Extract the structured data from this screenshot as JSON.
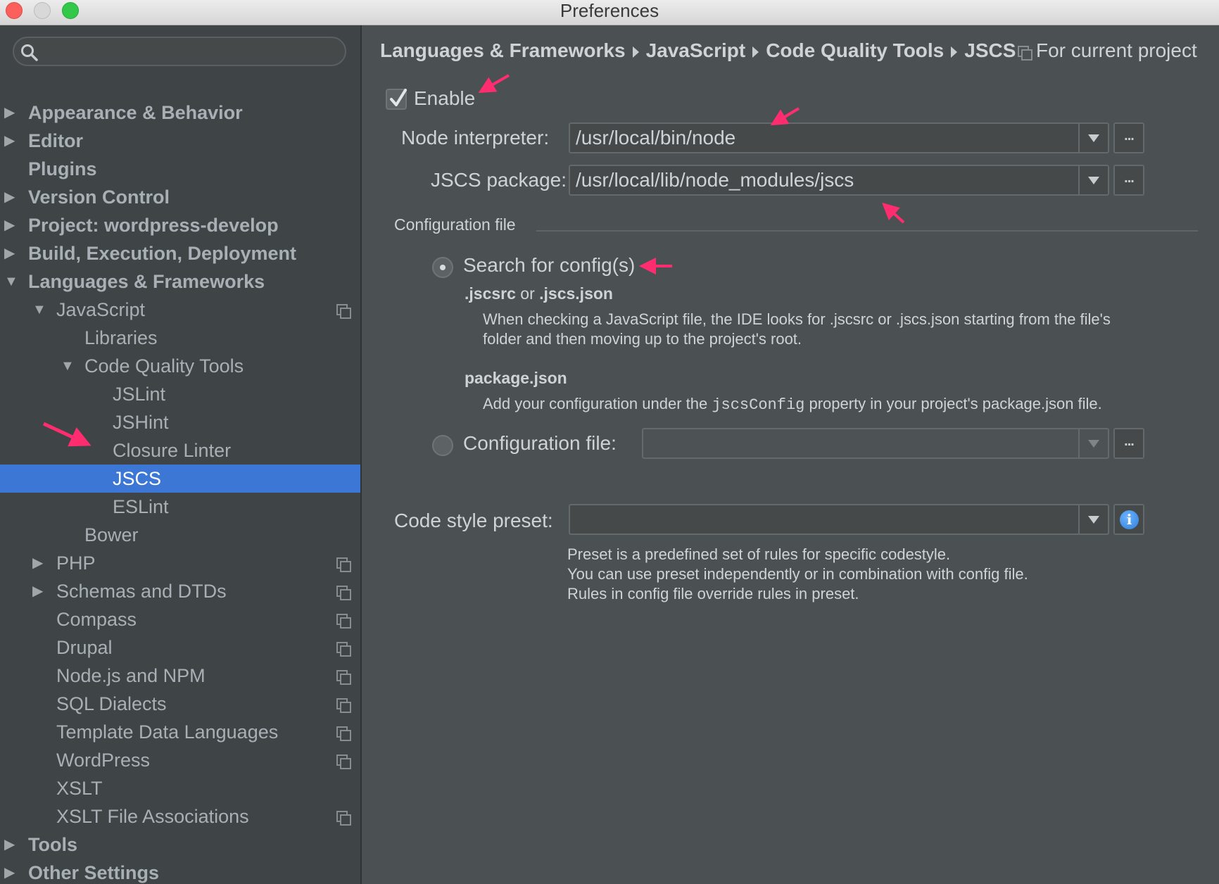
{
  "window": {
    "title": "Preferences"
  },
  "sidebar": {
    "search_placeholder": "",
    "items": [
      {
        "label": "Appearance & Behavior",
        "arrow": "▶"
      },
      {
        "label": "Editor",
        "arrow": "▶"
      },
      {
        "label": "Plugins",
        "arrow": ""
      },
      {
        "label": "Version Control",
        "arrow": "▶"
      },
      {
        "label": "Project: wordpress-develop",
        "arrow": "▶"
      },
      {
        "label": "Build, Execution, Deployment",
        "arrow": "▶"
      },
      {
        "label": "Languages & Frameworks",
        "arrow": "▼"
      },
      {
        "label": "JavaScript",
        "arrow": "▼"
      },
      {
        "label": "Libraries",
        "arrow": ""
      },
      {
        "label": "Code Quality Tools",
        "arrow": "▼"
      },
      {
        "label": "JSLint",
        "arrow": ""
      },
      {
        "label": "JSHint",
        "arrow": ""
      },
      {
        "label": "Closure Linter",
        "arrow": ""
      },
      {
        "label": "JSCS",
        "arrow": ""
      },
      {
        "label": "ESLint",
        "arrow": ""
      },
      {
        "label": "Bower",
        "arrow": ""
      },
      {
        "label": "PHP",
        "arrow": "▶"
      },
      {
        "label": "Schemas and DTDs",
        "arrow": "▶"
      },
      {
        "label": "Compass",
        "arrow": ""
      },
      {
        "label": "Drupal",
        "arrow": ""
      },
      {
        "label": "Node.js and NPM",
        "arrow": ""
      },
      {
        "label": "SQL Dialects",
        "arrow": ""
      },
      {
        "label": "Template Data Languages",
        "arrow": ""
      },
      {
        "label": "WordPress",
        "arrow": ""
      },
      {
        "label": "XSLT",
        "arrow": ""
      },
      {
        "label": "XSLT File Associations",
        "arrow": ""
      },
      {
        "label": "Tools",
        "arrow": "▶"
      },
      {
        "label": "Other Settings",
        "arrow": "▶"
      }
    ],
    "selected": "JSCS"
  },
  "breadcrumb": [
    "Languages & Frameworks",
    "JavaScript",
    "Code Quality Tools",
    "JSCS"
  ],
  "scope_label": "For current project",
  "enable": {
    "label": "Enable",
    "checked": true
  },
  "node_interpreter": {
    "label": "Node interpreter:",
    "value": "/usr/local/bin/node",
    "browse": "..."
  },
  "jscs_package": {
    "label": "JSCS package:",
    "value": "/usr/local/lib/node_modules/jscs",
    "browse": "..."
  },
  "config_section": {
    "title": "Configuration file",
    "search_option": {
      "label": "Search for config(s)",
      "checked": true,
      "heading_a": ".jscsrc",
      "heading_or": "or",
      "heading_b": ".jscs.json",
      "desc_line1": "When checking a JavaScript file, the IDE looks for .jscsrc or .jscs.json starting from the file's",
      "desc_line2": "folder and then moving up to the project's root.",
      "pkg_heading": "package.json",
      "pkg_desc_before": "Add your configuration under the ",
      "pkg_desc_code": "jscsConfig",
      "pkg_desc_after": " property in your project's package.json file."
    },
    "file_option": {
      "label": "Configuration file:",
      "checked": false,
      "value": "",
      "browse": "..."
    }
  },
  "code_style": {
    "label": "Code style preset:",
    "value": "",
    "info_icon": "i",
    "help_line1": "Preset is a predefined set of rules for specific codestyle.",
    "help_line2": "You can use preset independently or in combination with config file.",
    "help_line3": "Rules in config file override rules in preset."
  },
  "colors": {
    "accent": "#3c77d5",
    "annotation_arrow": "#ff2d6f",
    "background": "#4b5052",
    "sidebar": "#3f4447"
  }
}
